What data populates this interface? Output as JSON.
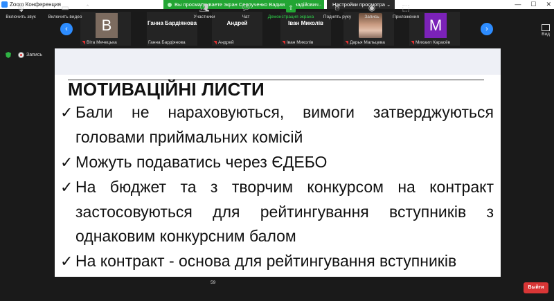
{
  "window": {
    "title": "Zoom Конференция",
    "share_banner": "Вы просматриваете экран Серпученко Вадим Геннадійович",
    "view_options": "Настройки просмотра ⌄"
  },
  "strip": {
    "video_label": "Вид",
    "tiles": [
      {
        "initial": "B",
        "color": "#7c6b5f",
        "label": "Віта Мечецька",
        "big": ""
      },
      {
        "initial": "",
        "color": "",
        "label": "Ганна Бардіянова",
        "big": "Ганна  Бардіянова"
      },
      {
        "initial": "",
        "color": "",
        "label": "Андрей",
        "big": "Андрей"
      },
      {
        "initial": "",
        "color": "",
        "label": "Іван Миколів",
        "big": "Іван  Миколів"
      },
      {
        "initial": "",
        "color": "",
        "label": "Дарья Мальцева",
        "big": ""
      },
      {
        "initial": "M",
        "color": "#7b22b8",
        "label": "Михаил Карасёв",
        "big": ""
      }
    ]
  },
  "recording_label": "Запись",
  "slide": {
    "title": "МОТИВАЦІЙНІ ЛИСТИ",
    "check": "✓",
    "bullets": [
      "Бали не нараховуються, вимоги затверджуються головами приймальних комісій",
      "Можуть подаватись через ЄДЕБО",
      "На бюджет та з творчим конкурсом на контракт застосовуються для рейтингування вступників з однаковим конкурсним балом",
      "На контракт - основа для рейтингування вступників"
    ]
  },
  "toolbar": {
    "audio": "Включить звук",
    "video": "Включить видео",
    "participants": "Участники",
    "participants_count": "59",
    "chat": "Чат",
    "share": "Демонстрация экрана",
    "raise_hand": "Поднять руку",
    "record": "Запись",
    "apps": "Приложения",
    "leave": "Выйти"
  }
}
